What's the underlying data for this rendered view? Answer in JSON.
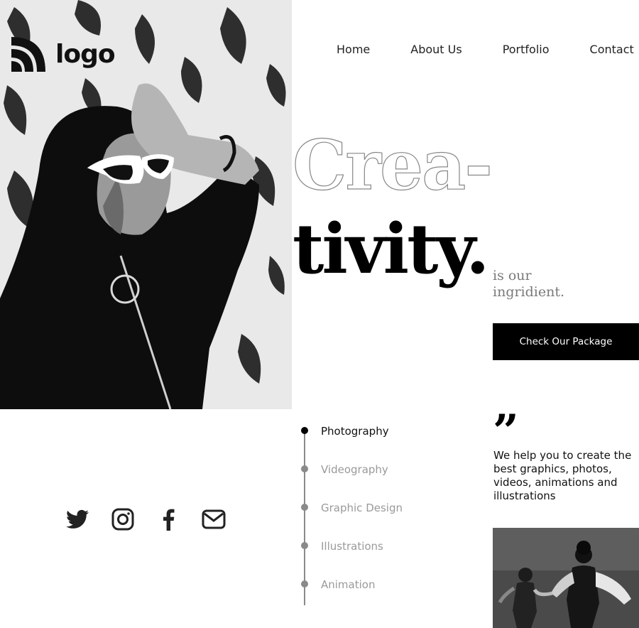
{
  "brand": {
    "logo_text": "logo",
    "logo_icon": "rss-wave-icon"
  },
  "nav": {
    "items": [
      "Home",
      "About Us",
      "Portfolio",
      "Contact"
    ]
  },
  "hero": {
    "headline_line1": "Crea-",
    "headline_line2": "tivity.",
    "tagline": "is our ingridient.",
    "cta_label": "Check Our Package",
    "photo": "woman-in-hood-with-sunglasses-photo"
  },
  "social": {
    "icons": [
      "twitter-icon",
      "instagram-icon",
      "facebook-icon",
      "mail-icon"
    ]
  },
  "services": {
    "active_index": 0,
    "items": [
      "Photography",
      "Videography",
      "Graphic Design",
      "Illustrations",
      "Animation"
    ]
  },
  "quote": {
    "mark": "”",
    "text": "We help you to create the best graphics, photos, videos, animations and illustrations"
  },
  "colors": {
    "accent": "#000000",
    "muted": "#8a8a8a",
    "background": "#ffffff"
  }
}
